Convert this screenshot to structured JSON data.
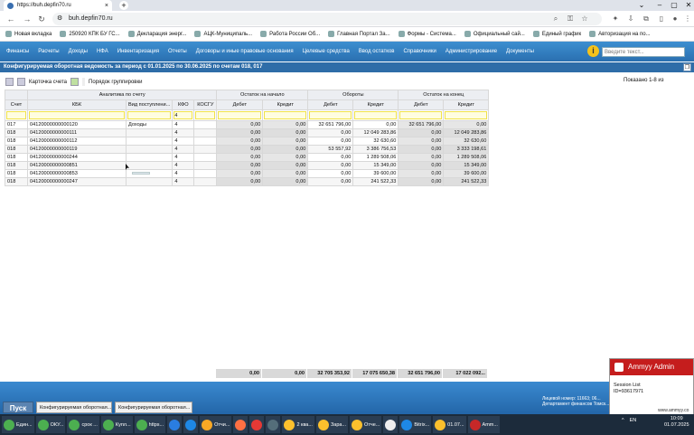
{
  "browser": {
    "tab_title": "https://buh.depfin70.ru",
    "url": "buh.depfin70.ru",
    "bookmarks": [
      "Новая вкладка",
      "250920 КПК БУ ГС...",
      "Декларация энерг...",
      "АЦК-Муниципаль...",
      "Работа России Об...",
      "Главная Портал За...",
      "Формы - Система...",
      "Официальный сай...",
      "Единый график",
      "Авторизация на по..."
    ]
  },
  "menu": {
    "items": [
      "Финансы",
      "Расчеты",
      "Доходы",
      "НФА",
      "Инвентаризация",
      "Отчеты",
      "Договоры и иные правовые основания",
      "Целевые средства",
      "Ввод остатков",
      "Справочники",
      "Администрирование",
      "Документы"
    ],
    "search_placeholder": "Введите текст..."
  },
  "report": {
    "title": "Конфигурируемая оборотная ведомость за период с 01.01.2025 по 30.06.2025 по счетам 018, 017",
    "toolbar": {
      "card": "Карточка счета",
      "group": "Порядок группировки"
    },
    "shown": "Показано 1-8 из"
  },
  "grid": {
    "group_headers": {
      "analytics": "Аналитика по счету",
      "start": "Остаток на начало",
      "turnover": "Обороты",
      "end": "Остаток на конец"
    },
    "columns": [
      "Счет",
      "КБК",
      "Вид поступлени...",
      "КФО",
      "КОСГУ",
      "Дебет",
      "Кредит",
      "Дебет",
      "Кредит",
      "Дебет",
      "Кредит"
    ],
    "kfo_filter": "4",
    "rows": [
      [
        "017",
        "04120000000000120",
        "Доходы",
        "4",
        "",
        "0,00",
        "0,00",
        "32 651 796,00",
        "0,00",
        "32 651 796,00",
        "0,00"
      ],
      [
        "018",
        "04120000000000111",
        "",
        "4",
        "",
        "0,00",
        "0,00",
        "0,00",
        "12 049 283,86",
        "0,00",
        "12 049 283,86"
      ],
      [
        "018",
        "04120000000000112",
        "",
        "4",
        "",
        "0,00",
        "0,00",
        "0,00",
        "32 630,60",
        "0,00",
        "32 630,60"
      ],
      [
        "018",
        "04120000000000119",
        "",
        "4",
        "",
        "0,00",
        "0,00",
        "53 557,92",
        "3 386 756,53",
        "0,00",
        "3 333 198,61"
      ],
      [
        "018",
        "04120000000000244",
        "",
        "4",
        "",
        "0,00",
        "0,00",
        "0,00",
        "1 289 508,06",
        "0,00",
        "1 289 508,06"
      ],
      [
        "018",
        "04120000000000851",
        "",
        "4",
        "",
        "0,00",
        "0,00",
        "0,00",
        "15 349,00",
        "0,00",
        "15 349,00"
      ],
      [
        "018",
        "04120000000000853",
        "",
        "4",
        "",
        "0,00",
        "0,00",
        "0,00",
        "39 600,00",
        "0,00",
        "39 600,00"
      ],
      [
        "018",
        "04120000000000247",
        "",
        "4",
        "",
        "0,00",
        "0,00",
        "0,00",
        "241 522,33",
        "0,00",
        "241 522,33"
      ]
    ],
    "totals": [
      "0,00",
      "0,00",
      "32 705 353,92",
      "17 075 650,38",
      "32 651 796,00",
      "17 022 092..."
    ]
  },
  "footer": {
    "info_line1": "Лицевой номер: 11663; 06...",
    "info_line2": "Департамент финансов Томск...",
    "start": "Пуск",
    "tabs": [
      "Конфигурируемая оборотная...",
      "Конфигурируемая оборотная..."
    ]
  },
  "ammyy": {
    "title": "Ammyy Admin",
    "line1": "Session List",
    "line2": "ID=93617971",
    "link": "www.ammyy.co"
  },
  "taskbar": {
    "items": [
      "Един...",
      "ОКУ...",
      "срок ...",
      "Купл...",
      "https...",
      "",
      "",
      "Отчи...",
      "",
      "",
      "",
      "2 ква...",
      "Зара...",
      "Отче...",
      "",
      "Bitrix...",
      "01.07...",
      "Amm..."
    ],
    "lang": "EN",
    "time": "10:09",
    "date": "01.07.2025"
  }
}
